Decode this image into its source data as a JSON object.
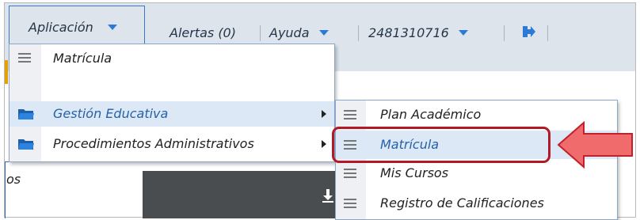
{
  "topbar": {
    "app_label": "Aplicación",
    "alerts_label": "Alertas (0)",
    "help_label": "Ayuda",
    "user_id": "2481310716"
  },
  "menu1": {
    "items": [
      {
        "label": "Matrícula",
        "icon": "list-icon"
      },
      {
        "label": "",
        "icon": ""
      },
      {
        "label": "Gestión Educativa",
        "icon": "folder-icon",
        "selected": true,
        "submenu": true
      },
      {
        "label": "Procedimientos Administrativos",
        "icon": "folder-icon",
        "submenu": true
      }
    ]
  },
  "menu2": {
    "items": [
      {
        "label": "Plan Académico",
        "icon": "list-icon"
      },
      {
        "label": "Matrícula",
        "icon": "list-icon",
        "selected": true
      },
      {
        "label": "Mis Cursos",
        "icon": "list-icon"
      },
      {
        "label": "Registro de Calificaciones",
        "icon": "list-icon"
      }
    ]
  },
  "background": {
    "partial_text": "os"
  },
  "colors": {
    "accent_blue": "#2b7bd6",
    "highlight_red": "#b11a24",
    "arrow_red": "#f06b6b"
  }
}
